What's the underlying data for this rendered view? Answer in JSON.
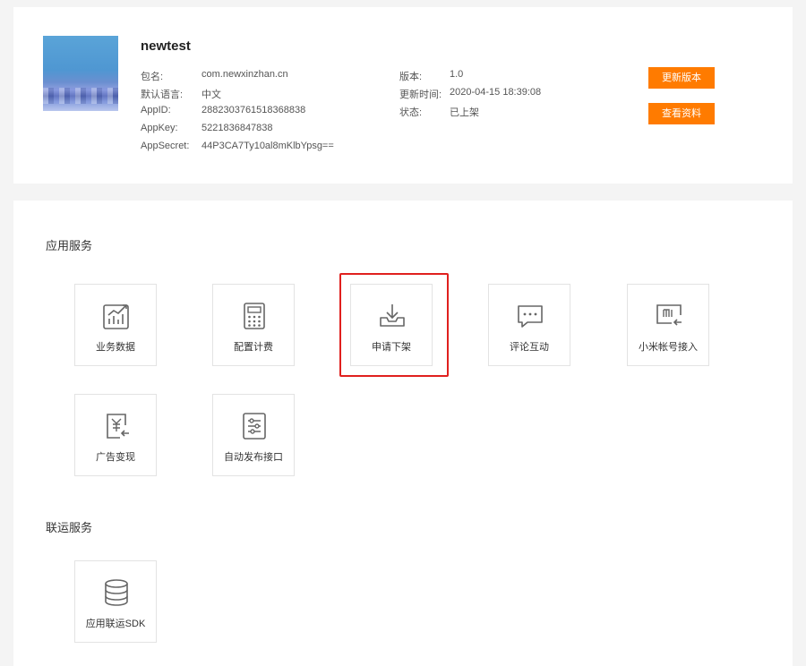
{
  "app": {
    "name": "newtest",
    "fields_left": [
      {
        "key": "包名:",
        "value": "com.newxinzhan.cn"
      },
      {
        "key": "默认语言:",
        "value": "中文"
      },
      {
        "key": "AppID:",
        "value": "2882303761518368838"
      },
      {
        "key": "AppKey:",
        "value": "5221836847838"
      },
      {
        "key": "AppSecret:",
        "value": "44P3CA7Ty10al8mKlbYpsg=="
      }
    ],
    "fields_right": [
      {
        "key": "版本:",
        "value": "1.0"
      },
      {
        "key": "更新时间:",
        "value": "2020-04-15 18:39:08"
      },
      {
        "key": "状态:",
        "value": "已上架"
      }
    ],
    "buttons": {
      "update": "更新版本",
      "view": "查看资料"
    },
    "accent_color": "#ff7b00"
  },
  "sections": [
    {
      "title": "应用服务",
      "tiles": [
        {
          "label": "业务数据",
          "icon": "chart-icon"
        },
        {
          "label": "配置计费",
          "icon": "calculator-icon"
        },
        {
          "label": "申请下架",
          "icon": "download-tray-icon",
          "highlighted": true
        },
        {
          "label": "评论互动",
          "icon": "comment-icon"
        },
        {
          "label": "小米帐号接入",
          "icon": "mi-login-icon"
        },
        {
          "label": "广告变现",
          "icon": "ad-yuan-icon"
        },
        {
          "label": "自动发布接口",
          "icon": "sliders-icon"
        }
      ]
    },
    {
      "title": "联运服务",
      "tiles": [
        {
          "label": "应用联运SDK",
          "icon": "database-icon"
        }
      ]
    }
  ],
  "highlight_color": "#e0201e"
}
